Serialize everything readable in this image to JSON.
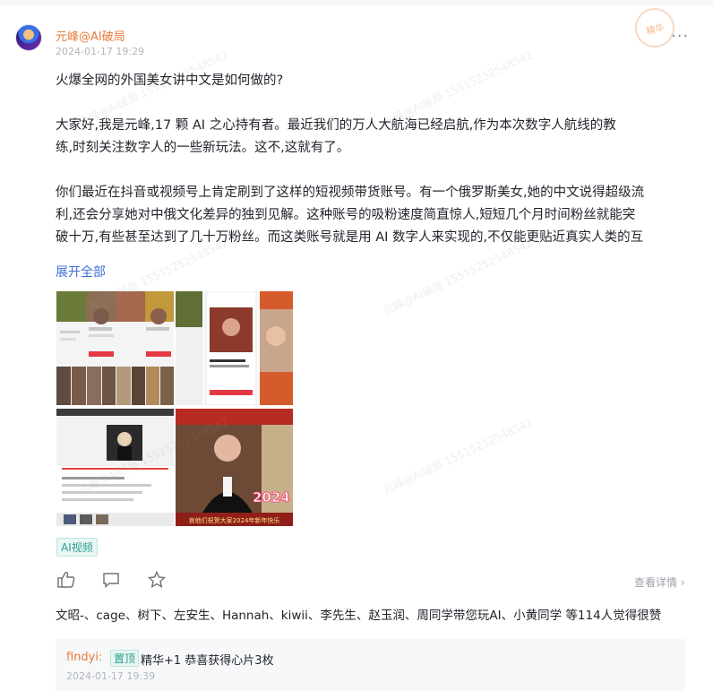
{
  "post": {
    "author": "元峰@AI破局",
    "time": "2024-01-17 19:29",
    "more_label": "···",
    "badge_text": "精华",
    "title": "火爆全网的外国美女讲中文是如何做的?",
    "p1_l1": "大家好,我是元峰,17 颗 AI 之心持有者。最近我们的万人大航海已经启航,作为本次数字人航线的教",
    "p1_l2": "练,时刻关注数字人的一些新玩法。这不,这就有了。",
    "p2_l1": "你们最近在抖音或视频号上肯定刷到了这样的短视频带货账号。有一个俄罗斯美女,她的中文说得超级流",
    "p2_l2": "利,还会分享她对中俄文化差异的独到见解。这种账号的吸粉速度简直惊人,短短几个月时间粉丝就能突",
    "p2_l3": "破十万,有些甚至达到了几十万粉丝。而这类账号就是用 AI 数字人来实现的,不仅能更贴近真实人类的互",
    "expand_label": "展开全部",
    "image_caption": "哀他们祝贺大家2024年新年快乐",
    "image_year": "2024",
    "tag": "AI视频",
    "details_label": "查看详情 ›",
    "likes_text": "文昭-、cage、树下、左安生、Hannah、kiwii、李先生、赵玉润、周同学带您玩AI、小黄同学 等114人觉得很赞"
  },
  "comment": {
    "user": "findyi:",
    "pin": "置顶",
    "text": "精华+1 恭喜获得心片3枚",
    "time": "2024-01-17 19:39"
  },
  "watermark": "元峰@AI破局 15515252548542",
  "colors": {
    "author": "#ea7b36",
    "link": "#3b6fd8",
    "tag": "#2a9d8f"
  },
  "icons": [
    "thumbs-up-icon",
    "comment-icon",
    "star-icon",
    "more-dots-icon"
  ]
}
